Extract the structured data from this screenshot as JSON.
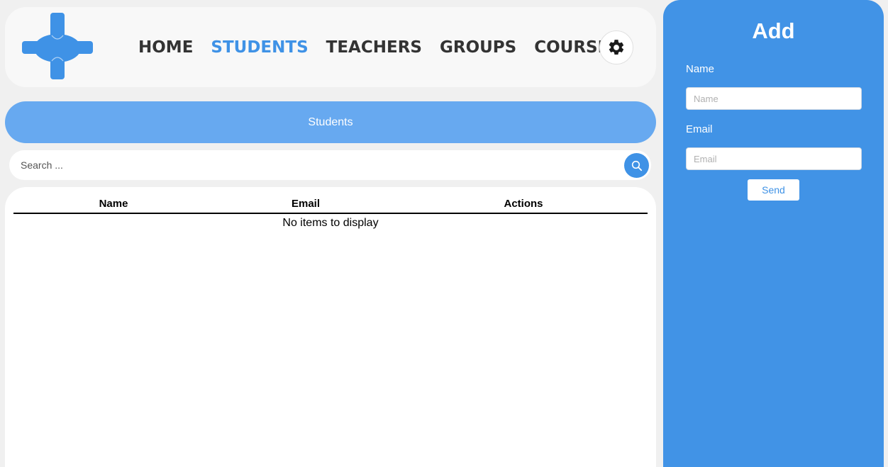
{
  "nav": {
    "items": [
      {
        "label": "HOME",
        "active": false
      },
      {
        "label": "STUDENTS",
        "active": true
      },
      {
        "label": "TEACHERS",
        "active": false
      },
      {
        "label": "GROUPS",
        "active": false
      },
      {
        "label": "COURSES",
        "active": false
      }
    ],
    "settings_icon": "gear-icon"
  },
  "banner": {
    "title": "Students"
  },
  "search": {
    "placeholder": "Search ...",
    "value": "",
    "icon": "search-icon"
  },
  "table": {
    "columns": [
      "Name",
      "Email",
      "Actions"
    ],
    "rows": [],
    "empty_message": "No items to display"
  },
  "add_panel": {
    "title": "Add",
    "name_label": "Name",
    "name_placeholder": "Name",
    "email_label": "Email",
    "email_placeholder": "Email",
    "send_label": "Send"
  },
  "colors": {
    "accent": "#3f92e6",
    "panel": "#4193e6",
    "banner": "#67a9f0",
    "background": "#f0f0f0"
  }
}
